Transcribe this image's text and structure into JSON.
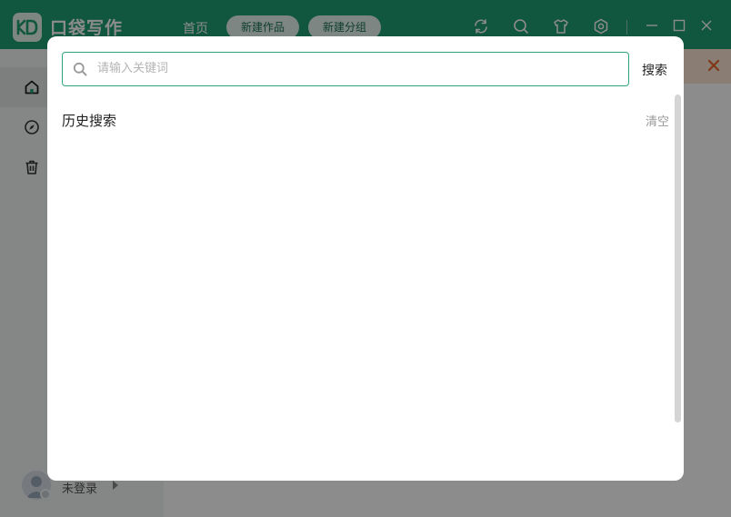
{
  "app": {
    "name": "口袋写作"
  },
  "header": {
    "nav_home": "首页",
    "new_work": "新建作品",
    "new_group": "新建分组",
    "icons": [
      "refresh-icon",
      "search-icon",
      "tshirt-icon",
      "settings-icon",
      "minimize-icon",
      "maximize-icon",
      "close-icon"
    ]
  },
  "sidebar": {
    "items": [
      {
        "icon": "home-icon",
        "active": true
      },
      {
        "icon": "compass-icon",
        "active": false
      },
      {
        "icon": "trash-icon",
        "active": false
      }
    ],
    "user": {
      "name": "未登录"
    }
  },
  "search_modal": {
    "placeholder": "请输入关键词",
    "value": "",
    "search_label": "搜索",
    "history_title": "历史搜索",
    "clear_label": "清空"
  },
  "colors": {
    "brand": "#1f9d72",
    "notice_bg": "#fbe3d2",
    "notice_close": "#e8672a",
    "input_border": "#2fa57d"
  }
}
